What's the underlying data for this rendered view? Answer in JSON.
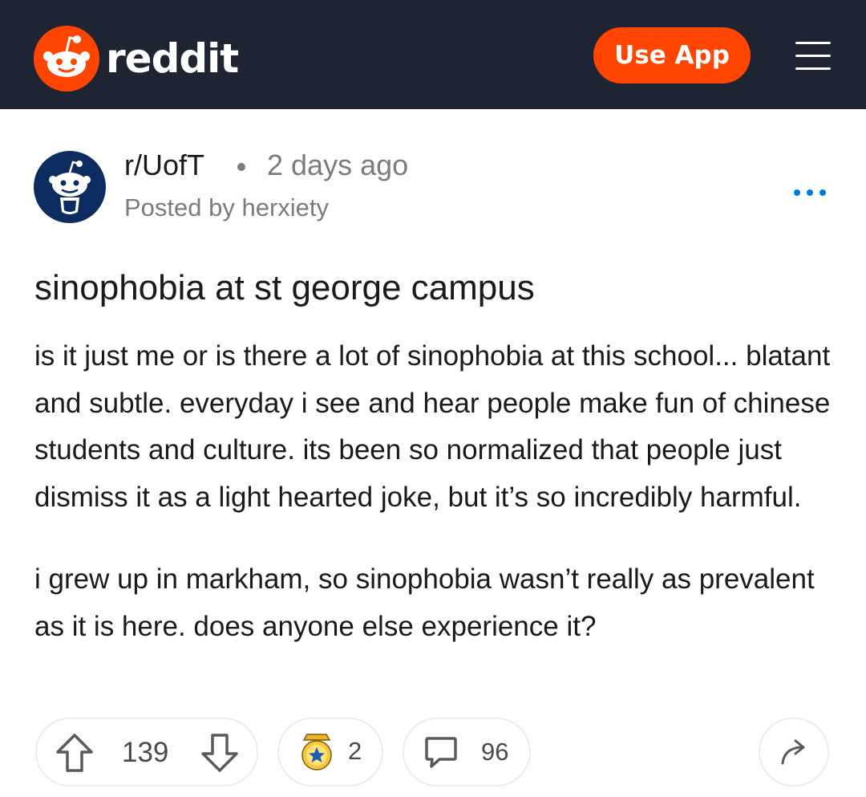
{
  "header": {
    "brand": "reddit",
    "use_app_label": "Use App",
    "logo_icon": "reddit-snoo-icon",
    "menu_icon": "hamburger-menu-icon",
    "colors": {
      "bar": "#1f2433",
      "accent": "#ff4500"
    }
  },
  "post_meta": {
    "subreddit": "r/UofT",
    "age": "2 days ago",
    "posted_by": "Posted by herxiety",
    "avatar_icon": "subreddit-snoo-icon",
    "more_icon": "more-options-icon"
  },
  "post": {
    "title": "sinophobia at st george campus",
    "body": [
      "is it just me or is there a lot of sinophobia at this school... blatant and subtle. everyday i see and hear people make fun of chinese students and culture. its been so normalized that people just dismiss it as a light hearted joke, but it’s so incredibly harmful.",
      "i grew up in markham, so sinophobia wasn’t really as prevalent as it is here. does anyone else experience it?"
    ]
  },
  "actions": {
    "votes": "139",
    "awards": "2",
    "comments": "96",
    "icons": {
      "upvote": "upvote-arrow-icon",
      "downvote": "downvote-arrow-icon",
      "award": "award-badge-icon",
      "comment": "comment-bubble-icon",
      "share": "share-arrow-icon"
    }
  }
}
